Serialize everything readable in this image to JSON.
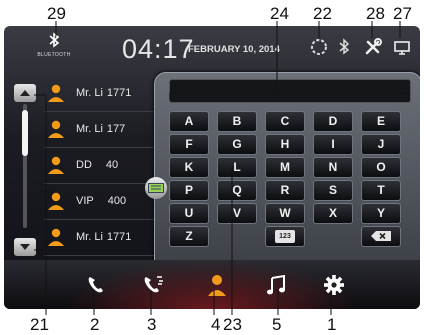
{
  "status": {
    "bluetooth_label": "BLUETOOTH",
    "time": "04:17",
    "date": "FEBRUARY 10, 2014"
  },
  "contacts": [
    {
      "name": "Mr. Li",
      "number": "1771"
    },
    {
      "name": "Mr. Li",
      "number": "177"
    },
    {
      "name": "DD",
      "number": "40"
    },
    {
      "name": "VIP",
      "number": "400"
    },
    {
      "name": "Mr. Li",
      "number": "1771"
    }
  ],
  "keyboard": {
    "rows": [
      [
        "A",
        "B",
        "C",
        "D",
        "E"
      ],
      [
        "F",
        "G",
        "H",
        "I",
        "J"
      ],
      [
        "K",
        "L",
        "M",
        "N",
        "O"
      ],
      [
        "P",
        "Q",
        "R",
        "S",
        "T"
      ],
      [
        "U",
        "V",
        "W",
        "X",
        "Y"
      ]
    ],
    "z_key": "Z",
    "num_key": "123"
  },
  "callouts": {
    "c29": "29",
    "c24": "24",
    "c22": "22",
    "c28": "28",
    "c27": "27",
    "c21": "21",
    "c2": "2",
    "c3": "3",
    "c4": "4",
    "c23": "23",
    "c5": "5",
    "c1": "1"
  },
  "colors": {
    "person": "#f29a1a",
    "accent": "#ff8c00"
  }
}
